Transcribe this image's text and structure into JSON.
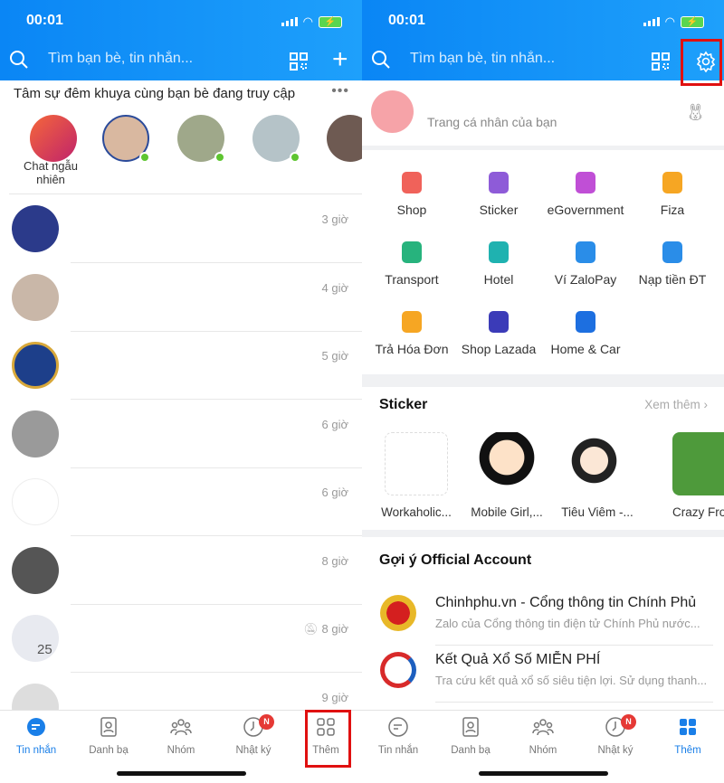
{
  "status_bar": {
    "time": "00:01"
  },
  "search": {
    "placeholder": "Tìm bạn bè, tin nhắn..."
  },
  "left": {
    "stories_title": "Tâm sự đêm khuya cùng bạn bè đang truy cập",
    "random_chat_label": "Chat ngẫu nhiên",
    "chats": [
      {
        "time": "3 giờ"
      },
      {
        "time": "4 giờ"
      },
      {
        "time": "5 giờ"
      },
      {
        "time": "6 giờ"
      },
      {
        "time": "6 giờ"
      },
      {
        "time": "8 giờ"
      },
      {
        "time": "8 giờ",
        "muted": true
      },
      {
        "time": "9 giờ"
      }
    ],
    "group_count": "25"
  },
  "right": {
    "profile_text": "Trang cá nhân của bạn",
    "services": [
      {
        "label": "Shop",
        "color": "#f0625a"
      },
      {
        "label": "Sticker",
        "color": "#8e5bd8"
      },
      {
        "label": "eGovernment",
        "color": "#c04fd6"
      },
      {
        "label": "Fiza",
        "color": "#f6a623"
      },
      {
        "label": "Transport",
        "color": "#27b37d"
      },
      {
        "label": "Hotel",
        "color": "#1fb2b0"
      },
      {
        "label": "Ví ZaloPay",
        "color": "#2a8de8"
      },
      {
        "label": "Nạp tiền ĐT",
        "color": "#2a8de8"
      },
      {
        "label": "Trả Hóa Đơn",
        "color": "#f6a623"
      },
      {
        "label": "Shop Lazada",
        "color": "#3b3bb8"
      },
      {
        "label": "Home & Car",
        "color": "#1d6fe0"
      }
    ],
    "sticker_title": "Sticker",
    "see_more": "Xem thêm",
    "stickers": [
      "Workaholic...",
      "Mobile Girl,...",
      "Tiêu Viêm -...",
      "Crazy Fro"
    ],
    "oa_title": "Gợi ý Official Account",
    "oa": [
      {
        "name": "Chinhphu.vn - Cổng thông tin Chính Phủ",
        "desc": "Zalo của Cổng thông tin điện tử Chính Phủ nước..."
      },
      {
        "name": "Kết Quả Xổ Số MIỄN PHÍ",
        "desc": "Tra cứu kết quả xổ số siêu tiện lợi. Sử dụng thanh..."
      }
    ]
  },
  "nav": {
    "items": [
      "Tin nhắn",
      "Danh bạ",
      "Nhóm",
      "Nhật ký",
      "Thêm"
    ],
    "diary_badge": "N"
  },
  "colors": {
    "accent": "#1a7fe8",
    "highlight": "#e01010",
    "online": "#5ec530"
  }
}
